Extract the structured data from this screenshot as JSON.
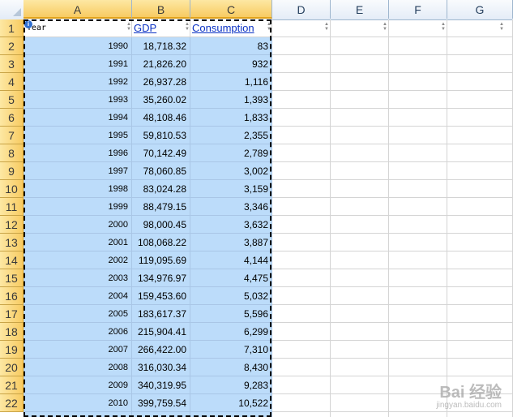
{
  "columns": [
    "A",
    "B",
    "C",
    "D",
    "E",
    "F",
    "G"
  ],
  "header_row": {
    "year": "Year",
    "gdp": "GDP",
    "consumption": "Consumption"
  },
  "rows": [
    {
      "year": "1990",
      "gdp": "18,718.32",
      "consumption": "83"
    },
    {
      "year": "1991",
      "gdp": "21,826.20",
      "consumption": "932"
    },
    {
      "year": "1992",
      "gdp": "26,937.28",
      "consumption": "1,116"
    },
    {
      "year": "1993",
      "gdp": "35,260.02",
      "consumption": "1,393"
    },
    {
      "year": "1994",
      "gdp": "48,108.46",
      "consumption": "1,833"
    },
    {
      "year": "1995",
      "gdp": "59,810.53",
      "consumption": "2,355"
    },
    {
      "year": "1996",
      "gdp": "70,142.49",
      "consumption": "2,789"
    },
    {
      "year": "1997",
      "gdp": "78,060.85",
      "consumption": "3,002"
    },
    {
      "year": "1998",
      "gdp": "83,024.28",
      "consumption": "3,159"
    },
    {
      "year": "1999",
      "gdp": "88,479.15",
      "consumption": "3,346"
    },
    {
      "year": "2000",
      "gdp": "98,000.45",
      "consumption": "3,632"
    },
    {
      "year": "2001",
      "gdp": "108,068.22",
      "consumption": "3,887"
    },
    {
      "year": "2002",
      "gdp": "119,095.69",
      "consumption": "4,144"
    },
    {
      "year": "2003",
      "gdp": "134,976.97",
      "consumption": "4,475"
    },
    {
      "year": "2004",
      "gdp": "159,453.60",
      "consumption": "5,032"
    },
    {
      "year": "2005",
      "gdp": "183,617.37",
      "consumption": "5,596"
    },
    {
      "year": "2006",
      "gdp": "215,904.41",
      "consumption": "6,299"
    },
    {
      "year": "2007",
      "gdp": "266,422.00",
      "consumption": "7,310"
    },
    {
      "year": "2008",
      "gdp": "316,030.34",
      "consumption": "8,430"
    },
    {
      "year": "2009",
      "gdp": "340,319.95",
      "consumption": "9,283"
    },
    {
      "year": "2010",
      "gdp": "399,759.54",
      "consumption": "10,522"
    }
  ],
  "watermark": {
    "main": "Bai 经验",
    "sub": "jingyan.baidu.com"
  },
  "icons": {
    "info": "info-icon",
    "filter": "filter-arrow-icon"
  },
  "colors": {
    "selection": "#bcdcfa",
    "header_selected": "#f8cb62",
    "link": "#0b32c4"
  }
}
